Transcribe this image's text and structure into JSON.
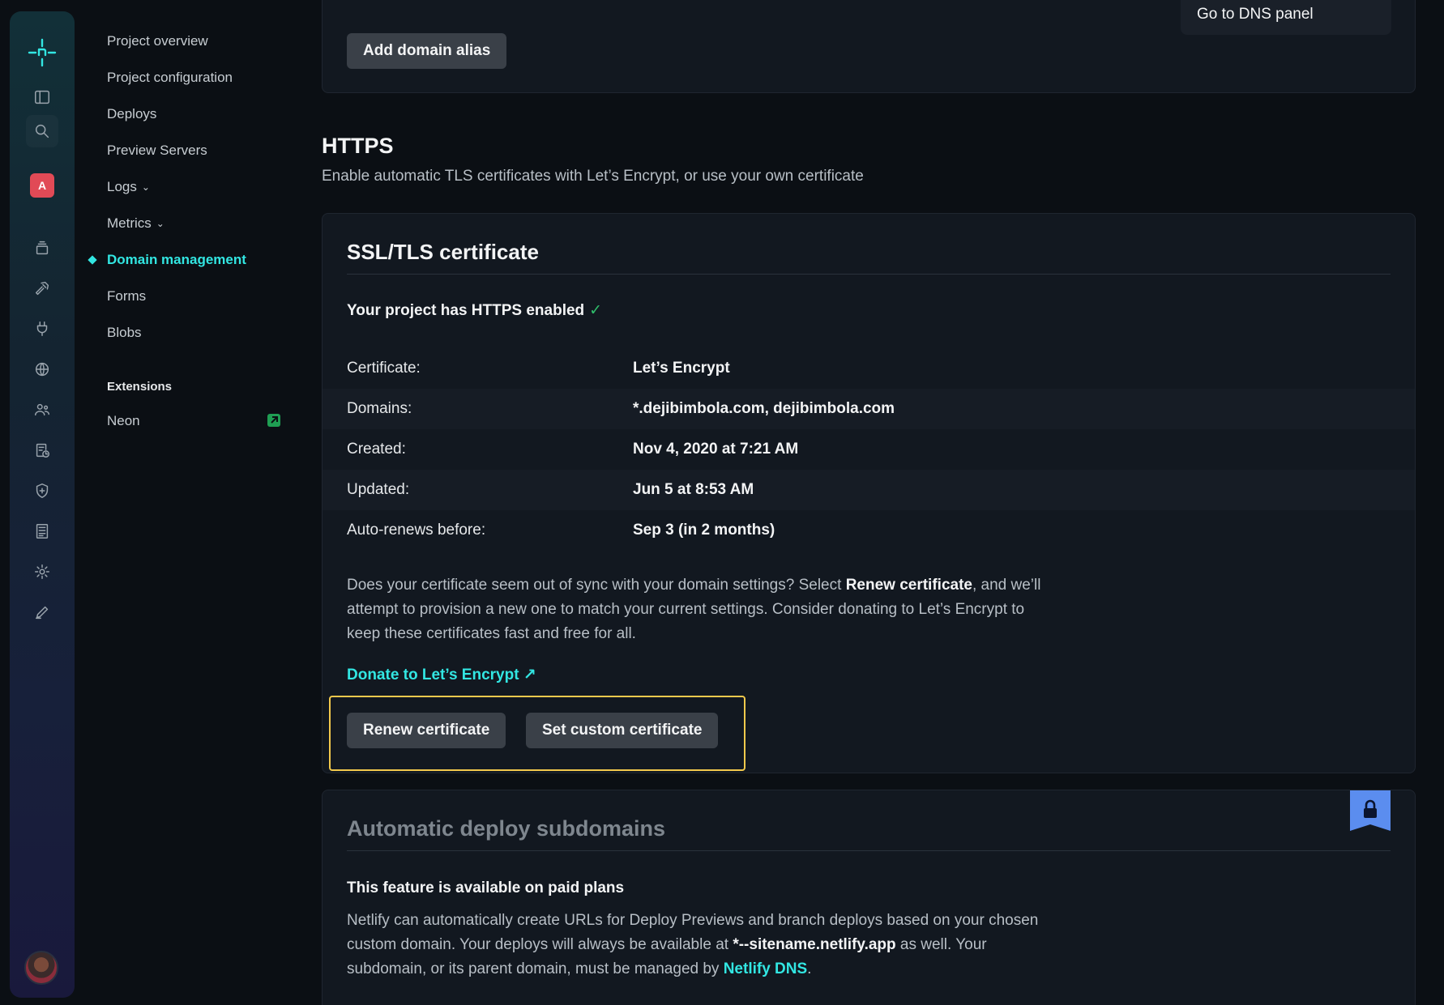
{
  "rail": {
    "team_initial": "A",
    "icons": [
      "netlify-logo",
      "sidebar-toggle-icon",
      "search-icon",
      "team-avatar",
      "layers-icon",
      "hammer-icon",
      "plug-icon",
      "globe-icon",
      "users-icon",
      "file-clock-icon",
      "shield-icon",
      "document-list-icon",
      "gear-icon",
      "pencil-icon",
      "user-avatar"
    ]
  },
  "subnav": {
    "items": [
      {
        "label": "Project overview"
      },
      {
        "label": "Project configuration"
      },
      {
        "label": "Deploys"
      },
      {
        "label": "Preview Servers"
      },
      {
        "label": "Logs"
      },
      {
        "label": "Metrics"
      },
      {
        "label": "Domain management"
      },
      {
        "label": "Forms"
      },
      {
        "label": "Blobs"
      }
    ],
    "extensions_heading": "Extensions",
    "extensions": [
      {
        "label": "Neon"
      }
    ]
  },
  "domains_card": {
    "add_alias_label": "Add domain alias",
    "dns_panel_label": "Go to DNS panel"
  },
  "https": {
    "title": "HTTPS",
    "description": "Enable automatic TLS certificates with Let’s Encrypt, or use your own certificate"
  },
  "ssl": {
    "title": "SSL/TLS certificate",
    "status": "Your project has HTTPS enabled",
    "status_check": "✓",
    "rows": [
      {
        "key": "Certificate:",
        "value": "Let’s Encrypt"
      },
      {
        "key": "Domains:",
        "value": "*.dejibimbola.com, dejibimbola.com"
      },
      {
        "key": "Created:",
        "value": "Nov 4, 2020 at 7:21 AM"
      },
      {
        "key": "Updated:",
        "value": "Jun 5 at 8:53 AM"
      },
      {
        "key": "Auto-renews before:",
        "value": "Sep 3 (in 2 months)"
      }
    ],
    "sync_text_1": "Does your certificate seem out of sync with your domain settings? Select ",
    "sync_bold": "Renew certificate",
    "sync_text_2": ", and we’ll attempt to provision a new one to match your current settings. Consider donating to Let’s Encrypt to keep these certificates fast and free for all.",
    "donate_label": "Donate to Let’s Encrypt ↗",
    "renew_label": "Renew certificate",
    "custom_label": "Set custom certificate"
  },
  "subdomains": {
    "title": "Automatic deploy subdomains",
    "paid_notice": "This feature is available on paid plans",
    "desc_1": "Netlify can automatically create URLs for Deploy Previews and branch deploys based on your chosen custom domain. Your deploys will always be available at ",
    "desc_bold": "*--sitename.netlify.app",
    "desc_2": " as well. Your subdomain, or its parent domain, must be managed by ",
    "desc_link": "Netlify DNS",
    "desc_3": "."
  },
  "colors": {
    "accent": "#32e6e2",
    "focus": "#f2c94c",
    "lock_badge": "#5b8def",
    "check": "#2fbd6a"
  }
}
